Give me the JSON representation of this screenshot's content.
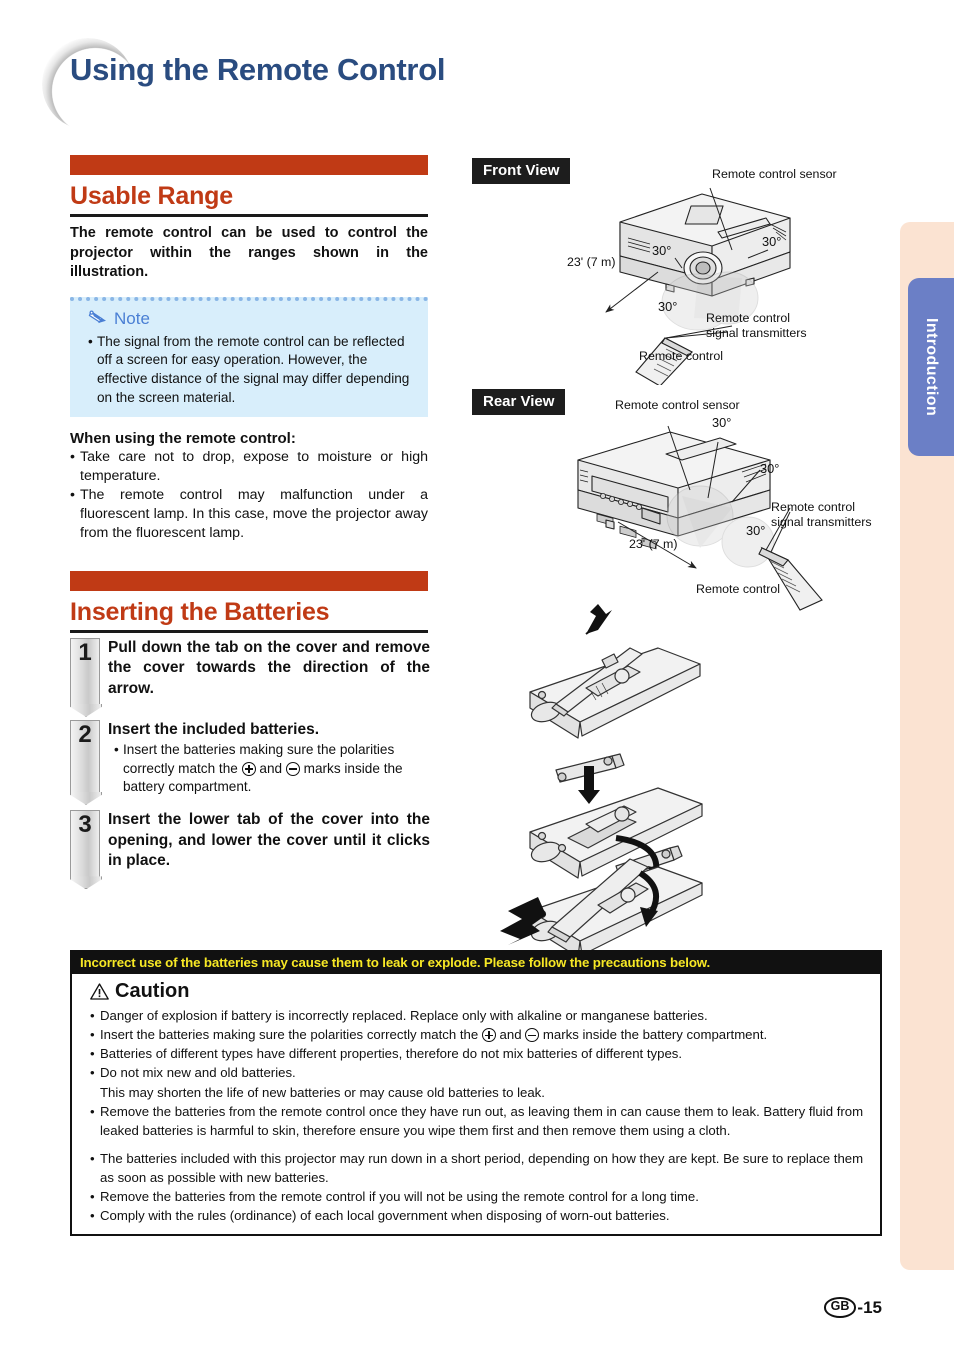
{
  "page": {
    "title": "Using the Remote Control",
    "tab_label": "Introduction",
    "footer_region": "GB",
    "footer_page": "-15",
    "colors": {
      "title": "#2a4c80",
      "accent_orange": "#c03a15",
      "tab_blue": "#6b7fc6",
      "tab_strip_peach": "#fbe3d2",
      "note_bg": "#d8eefb",
      "note_border": "#8ab6e6",
      "note_text_blue": "#4a7fd4",
      "caution_head_bg": "#111111",
      "caution_head_text": "#f7e825"
    }
  },
  "usable_range": {
    "heading": "Usable Range",
    "intro": "The remote control can be used to control the projector within the ranges shown in the illustration.",
    "note": {
      "icon": "pencil-icon",
      "label": "Note",
      "text": "The signal from the remote control can be reflected off a screen for easy operation. However, the effective distance of the signal may differ depending on the screen material."
    },
    "when_using_heading": "When using the remote control:",
    "when_using_bullets": [
      "Take care not to drop, expose to moisture or high temperature.",
      "The remote control may malfunction under a fluorescent lamp. In this case, move the projector away from the fluorescent lamp."
    ]
  },
  "inserting_batteries": {
    "heading": "Inserting the Batteries",
    "steps": [
      {
        "number": "1",
        "title": "Pull down the tab on the cover and remove the cover towards the direction of the arrow.",
        "sub": ""
      },
      {
        "number": "2",
        "title": "Insert the included batteries.",
        "sub_pre": "Insert the batteries making sure the polarities correctly match the ",
        "sub_mid": " and ",
        "sub_post": " marks inside the battery compartment."
      },
      {
        "number": "3",
        "title": "Insert the lower tab of the cover into the opening, and lower the cover until it clicks in place.",
        "sub": ""
      }
    ]
  },
  "diagrams": {
    "front": {
      "tag": "Front View",
      "sensor_label": "Remote control sensor",
      "transmitters_label": "Remote control\nsignal transmitters",
      "remote_label": "Remote control",
      "distance": "23' (7 m)",
      "angles": [
        "30°",
        "30°",
        "30°"
      ]
    },
    "rear": {
      "tag": "Rear View",
      "sensor_label": "Remote control sensor",
      "transmitters_label": "Remote control\nsignal transmitters",
      "remote_label": "Remote control",
      "distance": "23' (7 m)",
      "angles": [
        "30°",
        "30°",
        "30°"
      ]
    }
  },
  "caution": {
    "header": "Incorrect use of the batteries may cause them to leak or explode. Please follow the precautions below.",
    "title": "Caution",
    "icon": "warning-triangle-icon",
    "items": [
      {
        "text": "Danger of explosion if battery is incorrectly replaced. Replace only with alkaline or manganese batteries."
      },
      {
        "text_pre": "Insert the batteries making sure the polarities correctly match the ",
        "text_mid": " and ",
        "text_post": " marks inside the battery compartment."
      },
      {
        "text": "Batteries of different types have different properties, therefore do not mix batteries of different types."
      },
      {
        "text": "Do not mix new and old batteries.",
        "cont": "This may shorten the life of new batteries or may cause old batteries to leak."
      },
      {
        "text": "Remove the batteries from the remote control once they have run out, as leaving them in can cause them to leak. Battery fluid from leaked batteries is harmful to skin, therefore ensure you wipe them first and then remove them using a cloth."
      },
      {
        "text": "The batteries included with this projector may run down in a short period, depending on how they are kept. Be sure to replace them as soon as possible with new batteries."
      },
      {
        "text": "Remove the batteries from the remote control if you will not be using the remote control for a long time."
      },
      {
        "text": "Comply with the rules (ordinance) of each local government when disposing of worn-out batteries."
      }
    ]
  }
}
